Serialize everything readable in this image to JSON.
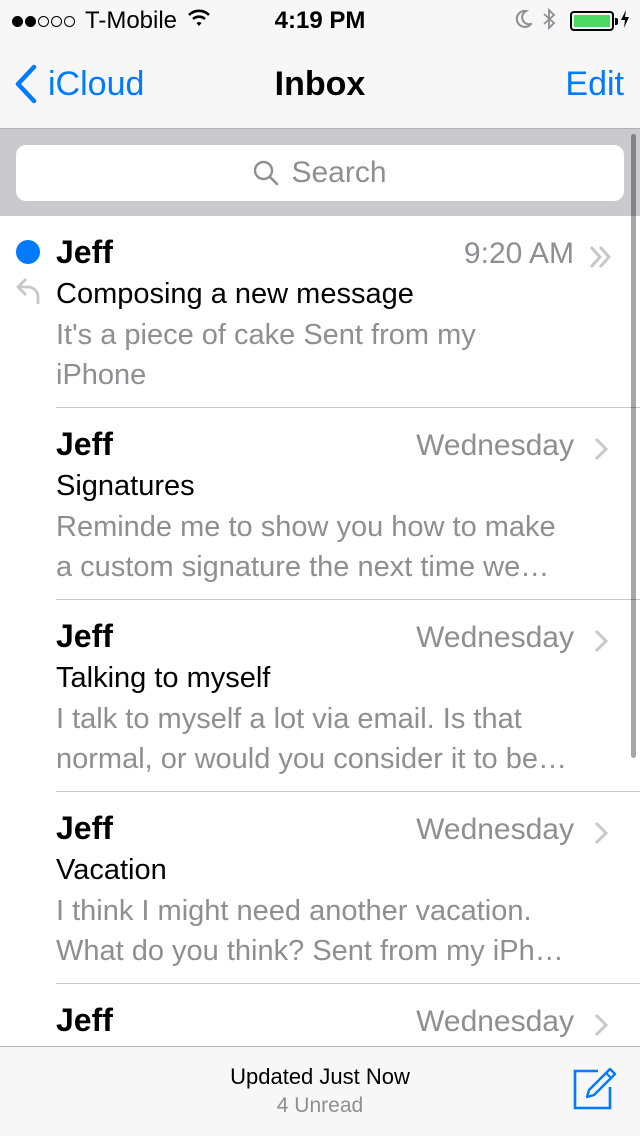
{
  "status_bar": {
    "carrier": "T-Mobile",
    "signal_bars_filled": 2,
    "signal_bars_total": 5,
    "time": "4:19 PM",
    "battery_level": 1.0,
    "battery_color": "#4cd964"
  },
  "nav": {
    "back_label": "iCloud",
    "title": "Inbox",
    "edit_label": "Edit"
  },
  "search": {
    "placeholder": "Search"
  },
  "messages": [
    {
      "sender": "Jeff",
      "date": "9:20 AM",
      "subject": "Composing a new message",
      "preview_line1": "It's a piece of cake Sent from my",
      "preview_line2": "iPhone",
      "unread": true,
      "replied": true,
      "chevron": "double-chevron-icon"
    },
    {
      "sender": "Jeff",
      "date": "Wednesday",
      "subject": "Signatures",
      "preview_line1": "Reminde me to show you how to make",
      "preview_line2": "a custom signature the next time we…",
      "unread": false,
      "replied": false,
      "chevron": "chevron-right-icon"
    },
    {
      "sender": "Jeff",
      "date": "Wednesday",
      "subject": "Talking to myself",
      "preview_line1": "I talk to myself a lot via email. Is that",
      "preview_line2": "normal, or would you consider it to be…",
      "unread": false,
      "replied": false,
      "chevron": "chevron-right-icon"
    },
    {
      "sender": "Jeff",
      "date": "Wednesday",
      "subject": "Vacation",
      "preview_line1": "I think I might need another vacation.",
      "preview_line2": "What do you think? Sent from my iPh…",
      "unread": false,
      "replied": false,
      "chevron": "chevron-right-icon"
    },
    {
      "sender": "Jeff",
      "date": "Wednesday",
      "subject": "",
      "preview_line1": "",
      "preview_line2": "",
      "unread": false,
      "replied": false,
      "chevron": "chevron-right-icon"
    }
  ],
  "toolbar": {
    "status": "Updated Just Now",
    "unread_count": "4 Unread"
  },
  "colors": {
    "accent": "#007aff",
    "secondary_text": "#8e8e93",
    "separator": "#c8c7cc"
  }
}
